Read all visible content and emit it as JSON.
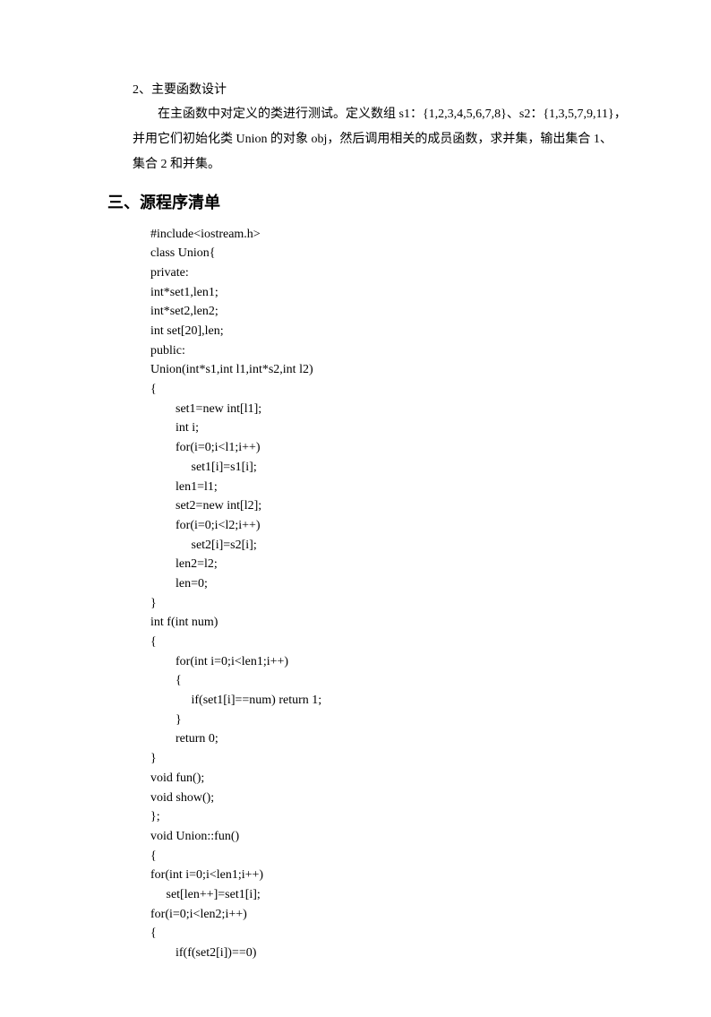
{
  "section_sub": "2、主要函数设计",
  "paragraph_lines": [
    "在主函数中对定义的类进行测试。定义数组 s1：{1,2,3,4,5,6,7,8}、s2：{1,3,5,7,9,11}，",
    "并用它们初始化类 Union 的对象 obj，然后调用相关的成员函数，求并集，输出集合 1、",
    "集合 2 和并集。"
  ],
  "heading": "三、源程序清单",
  "code_lines": [
    "#include<iostream.h>",
    "class Union{",
    "private:",
    "int*set1,len1;",
    "int*set2,len2;",
    "int set[20],len;",
    "public:",
    "Union(int*s1,int l1,int*s2,int l2)",
    "{",
    "        set1=new int[l1];",
    "        int i;",
    "        for(i=0;i<l1;i++)",
    "             set1[i]=s1[i];",
    "        len1=l1;",
    "        set2=new int[l2];",
    "        for(i=0;i<l2;i++)",
    "             set2[i]=s2[i];",
    "        len2=l2;",
    "        len=0;",
    "}",
    "int f(int num)",
    "{",
    "        for(int i=0;i<len1;i++)",
    "        {",
    "             if(set1[i]==num) return 1;",
    "        }",
    "        return 0;",
    "}",
    "void fun();",
    "void show();",
    "};",
    "void Union::fun()",
    "{",
    "for(int i=0;i<len1;i++)",
    "     set[len++]=set1[i];",
    "for(i=0;i<len2;i++)",
    "{",
    "        if(f(set2[i])==0)"
  ]
}
